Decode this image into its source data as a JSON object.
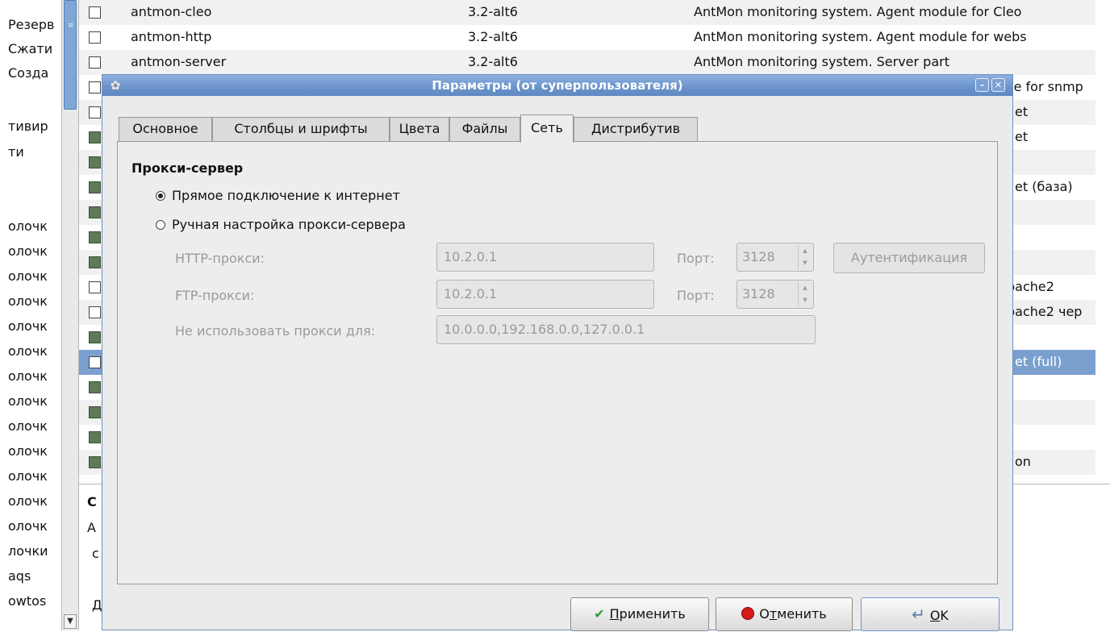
{
  "left_panel": {
    "items": [
      "Резерв",
      "Сжати",
      "Созда",
      "тивир",
      "ти",
      "олочк",
      "олочк",
      "олочк",
      "олочк",
      "олочк",
      "олочк",
      "олочк",
      "олочк",
      "олочк",
      "олочк",
      "олочк",
      "олочк",
      "олочк",
      "лочки",
      "aqs",
      "owtos"
    ]
  },
  "packages": {
    "rows": [
      {
        "name": "antmon-cleo",
        "version": "3.2-alt6",
        "description": "AntMon monitoring system. Agent module for Cleo"
      },
      {
        "name": "antmon-http",
        "version": "3.2-alt6",
        "description": "AntMon monitoring system. Agent module for webs"
      },
      {
        "name": "antmon-server",
        "version": "3.2-alt6",
        "description": "AntMon monitoring system. Server part"
      }
    ],
    "partial_desc": [
      "ule for snmp",
      "et",
      "et",
      "et (база)",
      "pache2",
      "pache2 чер",
      "et (full)",
      "on"
    ]
  },
  "bottom_pane": {
    "lines": [
      "С",
      "А",
      "с",
      "Д"
    ]
  },
  "dialog": {
    "title": "Параметры (от суперпользователя)",
    "minimize_glyph": "–",
    "close_glyph": "✕",
    "tabs": [
      "Основное",
      "Столбцы и шрифты",
      "Цвета",
      "Файлы",
      "Сеть",
      "Дистрибутив"
    ],
    "active_tab": "Сеть",
    "section_title": "Прокси-сервер",
    "radio_direct": "Прямое подключение к интернет",
    "radio_manual": "Ручная настройка прокси-сервера",
    "http_label": "HTTP-прокси:",
    "http_value": "10.2.0.1",
    "http_port_label": "Порт:",
    "http_port": "3128",
    "auth_button": "Аутентификация",
    "ftp_label": "FTP-прокси:",
    "ftp_value": "10.2.0.1",
    "ftp_port_label": "Порт:",
    "ftp_port": "3128",
    "noproxy_label": "Не использовать прокси для:",
    "noproxy_value": "10.0.0.0,192.168.0.0,127.0.0.1",
    "apply_pre": "",
    "apply_mnemonic": "П",
    "apply_post": "рименить",
    "cancel_pre": "О",
    "cancel_mnemonic": "т",
    "cancel_post": "менить",
    "ok_pre": "",
    "ok_mnemonic": "O",
    "ok_post": "K"
  }
}
